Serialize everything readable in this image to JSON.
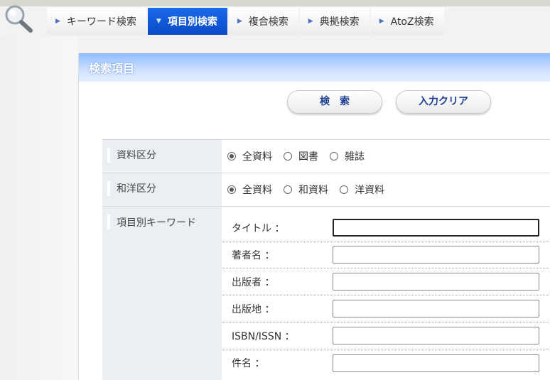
{
  "tabs": [
    {
      "label": "キーワード検索",
      "active": false
    },
    {
      "label": "項目別検索",
      "active": true
    },
    {
      "label": "複合検索",
      "active": false
    },
    {
      "label": "典拠検索",
      "active": false
    },
    {
      "label": "AtoZ検索",
      "active": false
    }
  ],
  "panel": {
    "title": "検索項目",
    "search_button": "検　索",
    "clear_button": "入力クリア"
  },
  "material_type": {
    "label": "資料区分",
    "options": [
      "全資料",
      "図書",
      "雑誌"
    ],
    "selected": "全資料"
  },
  "language_type": {
    "label": "和洋区分",
    "options": [
      "全資料",
      "和資料",
      "洋資料"
    ],
    "selected": "全資料"
  },
  "keywords": {
    "label": "項目別キーワード",
    "fields": [
      {
        "label": "タイトル ：",
        "value": ""
      },
      {
        "label": "著者名 ：",
        "value": ""
      },
      {
        "label": "出版者 ：",
        "value": ""
      },
      {
        "label": "出版地 ：",
        "value": ""
      },
      {
        "label": "ISBN/ISSN ：",
        "value": ""
      },
      {
        "label": "件名 ：",
        "value": ""
      }
    ]
  },
  "colors": {
    "active_tab": "#0a49c8",
    "header_gradient": "#8fbcff",
    "button_text": "#1d3f8f"
  },
  "icons": {
    "logo": "magnifier-icon",
    "tab_marker": "triangle-right-icon",
    "active_tab_marker": "triangle-down-icon"
  }
}
